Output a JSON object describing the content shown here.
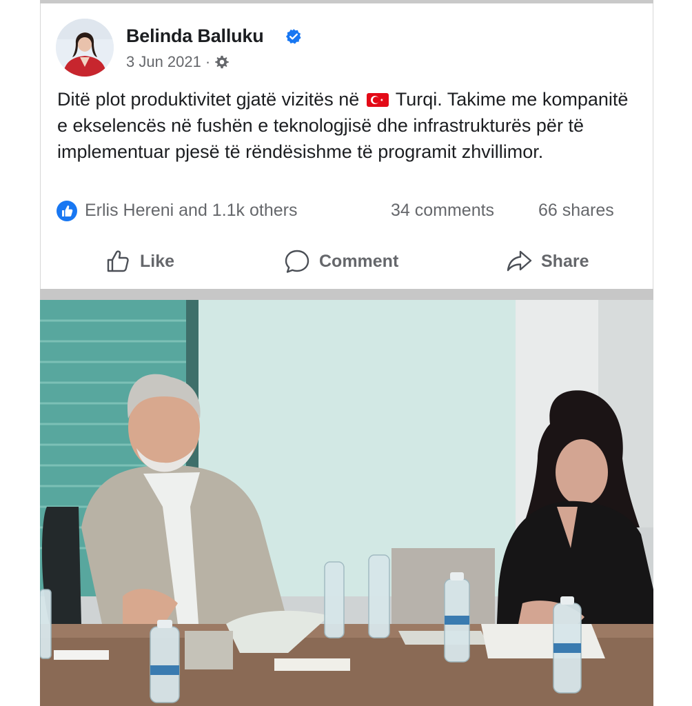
{
  "post": {
    "author": "Belinda Balluku",
    "date": "3 Jun 2021",
    "separator": "·",
    "text_before_flag": "Ditë plot produktivitet gjatë vizitës në",
    "text_after_flag": "Turqi. Takime me kompanitë e ekselencës në fushën e teknologjisë dhe infrastrukturës për të implementuar pjesë të rëndësishme të programit zhvillimor."
  },
  "stats": {
    "reactions": "Erlis Hereni and 1.1k others",
    "comments": "34 comments",
    "shares": "66 shares"
  },
  "actions": {
    "like": "Like",
    "comment": "Comment",
    "share": "Share"
  },
  "icons": {
    "verified": "verified-badge-icon",
    "privacy": "gear-icon",
    "flag": "turkey-flag-icon",
    "like_badge": "like-reaction-icon",
    "like": "thumbs-up-icon",
    "comment": "speech-bubble-icon",
    "share": "share-arrow-icon"
  },
  "colors": {
    "facebook_blue": "#1877f2",
    "text": "#1c1e21",
    "secondary_text": "#65676b",
    "flag_red": "#e30a17"
  }
}
